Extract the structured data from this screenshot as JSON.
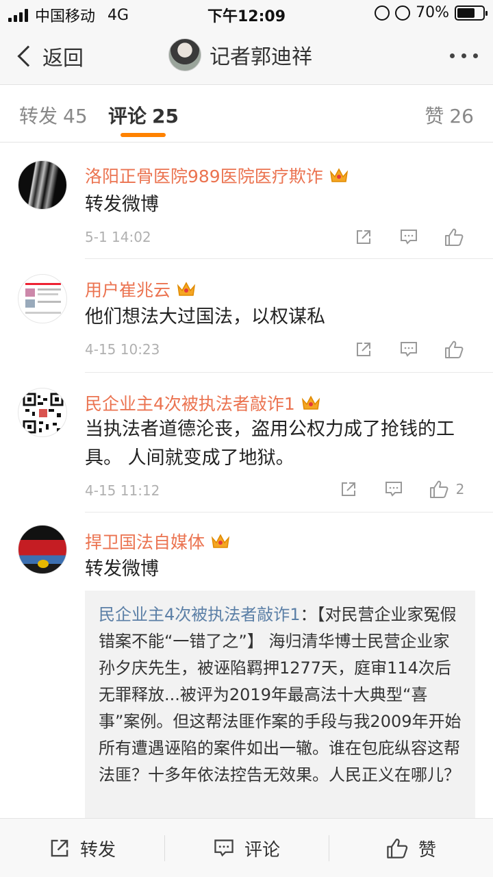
{
  "status_bar": {
    "carrier": "中国移动",
    "network": "4G",
    "time": "下午12:09",
    "battery": "70%",
    "battery_level": 0.7
  },
  "nav": {
    "back_label": "返回",
    "title": "记者郭迪祥",
    "more_icon": "more-icon"
  },
  "tabs": {
    "repost": {
      "label": "转发",
      "count": "45"
    },
    "comment": {
      "label": "评论",
      "count": "25"
    },
    "like": {
      "label": "赞",
      "count": "26"
    }
  },
  "colors": {
    "accent": "#ff8200",
    "username": "#eb7350",
    "link": "#5b7fa6"
  },
  "comments": [
    {
      "name": "洛阳正骨医院989医院医疗欺诈",
      "text": "转发微博",
      "time": "5-1 14:02",
      "likes": ""
    },
    {
      "name": "用户崔兆云",
      "text": "他们想法大过国法，以权谋私",
      "time": "4-15 10:23",
      "likes": ""
    },
    {
      "name": "民企业主4次被执法者敲诈1",
      "text": "当执法者道德沦丧，盗用公权力成了抢钱的工具。 人间就变成了地狱。",
      "time": "4-15 11:12",
      "likes": "2"
    },
    {
      "name": "捍卫国法自媒体",
      "text": "转发微博",
      "time": "",
      "likes": ""
    }
  ],
  "quoted": {
    "name": "民企业主4次被执法者敲诈1",
    "text": "：【对民营企业家冤假错案不能“一错了之”】 海归清华博士民营企业家孙夕庆先生，被诬陷羁押1277天，庭审114次后无罪释放...被评为2019年最高法十大典型“喜事”案例。但这帮法匪作案的手段与我2009年开始所有遭遇诬陷的案件如出一辙。谁在包庇纵容这帮法匪？十多年依法控告无效果。人民正义在哪儿？"
  },
  "bottom": {
    "repost_label": "转发",
    "comment_label": "评论",
    "like_label": "赞"
  }
}
